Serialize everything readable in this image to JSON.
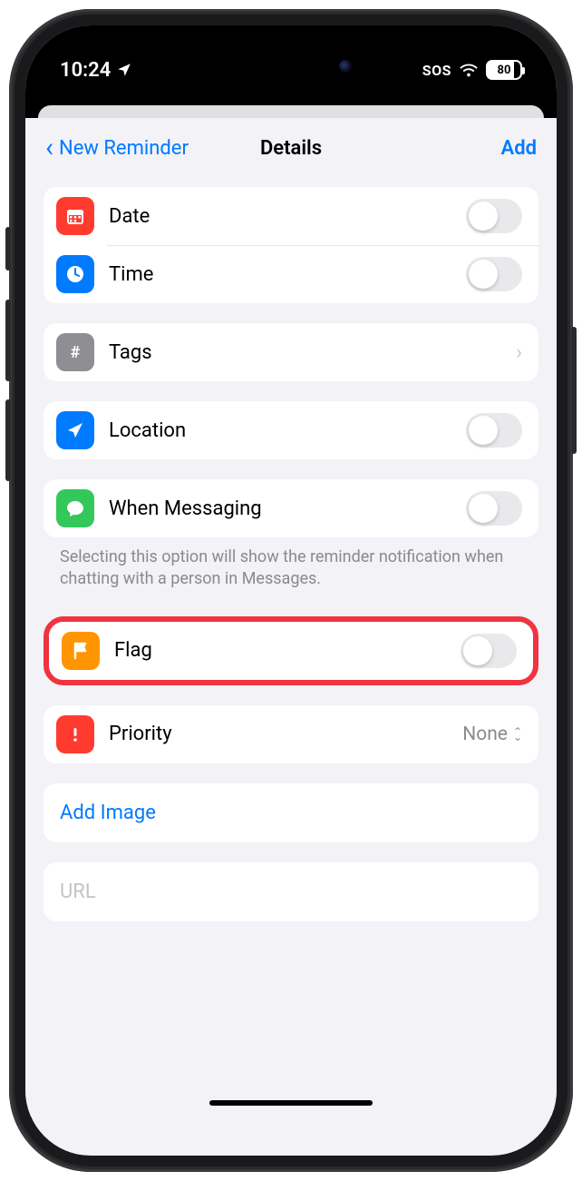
{
  "status": {
    "time": "10:24",
    "sos": "SOS",
    "battery": "80"
  },
  "nav": {
    "back": "New Reminder",
    "title": "Details",
    "action": "Add"
  },
  "rows": {
    "date": "Date",
    "time": "Time",
    "tags": "Tags",
    "location": "Location",
    "messaging": "When Messaging",
    "messaging_footer": "Selecting this option will show the reminder notification when chatting with a person in Messages.",
    "flag": "Flag",
    "priority": "Priority",
    "priority_value": "None",
    "add_image": "Add Image",
    "url_placeholder": "URL"
  },
  "icons": {
    "date": "calendar-icon",
    "time": "clock-icon",
    "tags": "hash-icon",
    "location": "nav-arrow-icon",
    "messaging": "message-icon",
    "flag": "flag-icon",
    "priority": "exclaim-icon"
  },
  "colors": {
    "accent": "#007aff",
    "highlight": "#ef3340"
  }
}
